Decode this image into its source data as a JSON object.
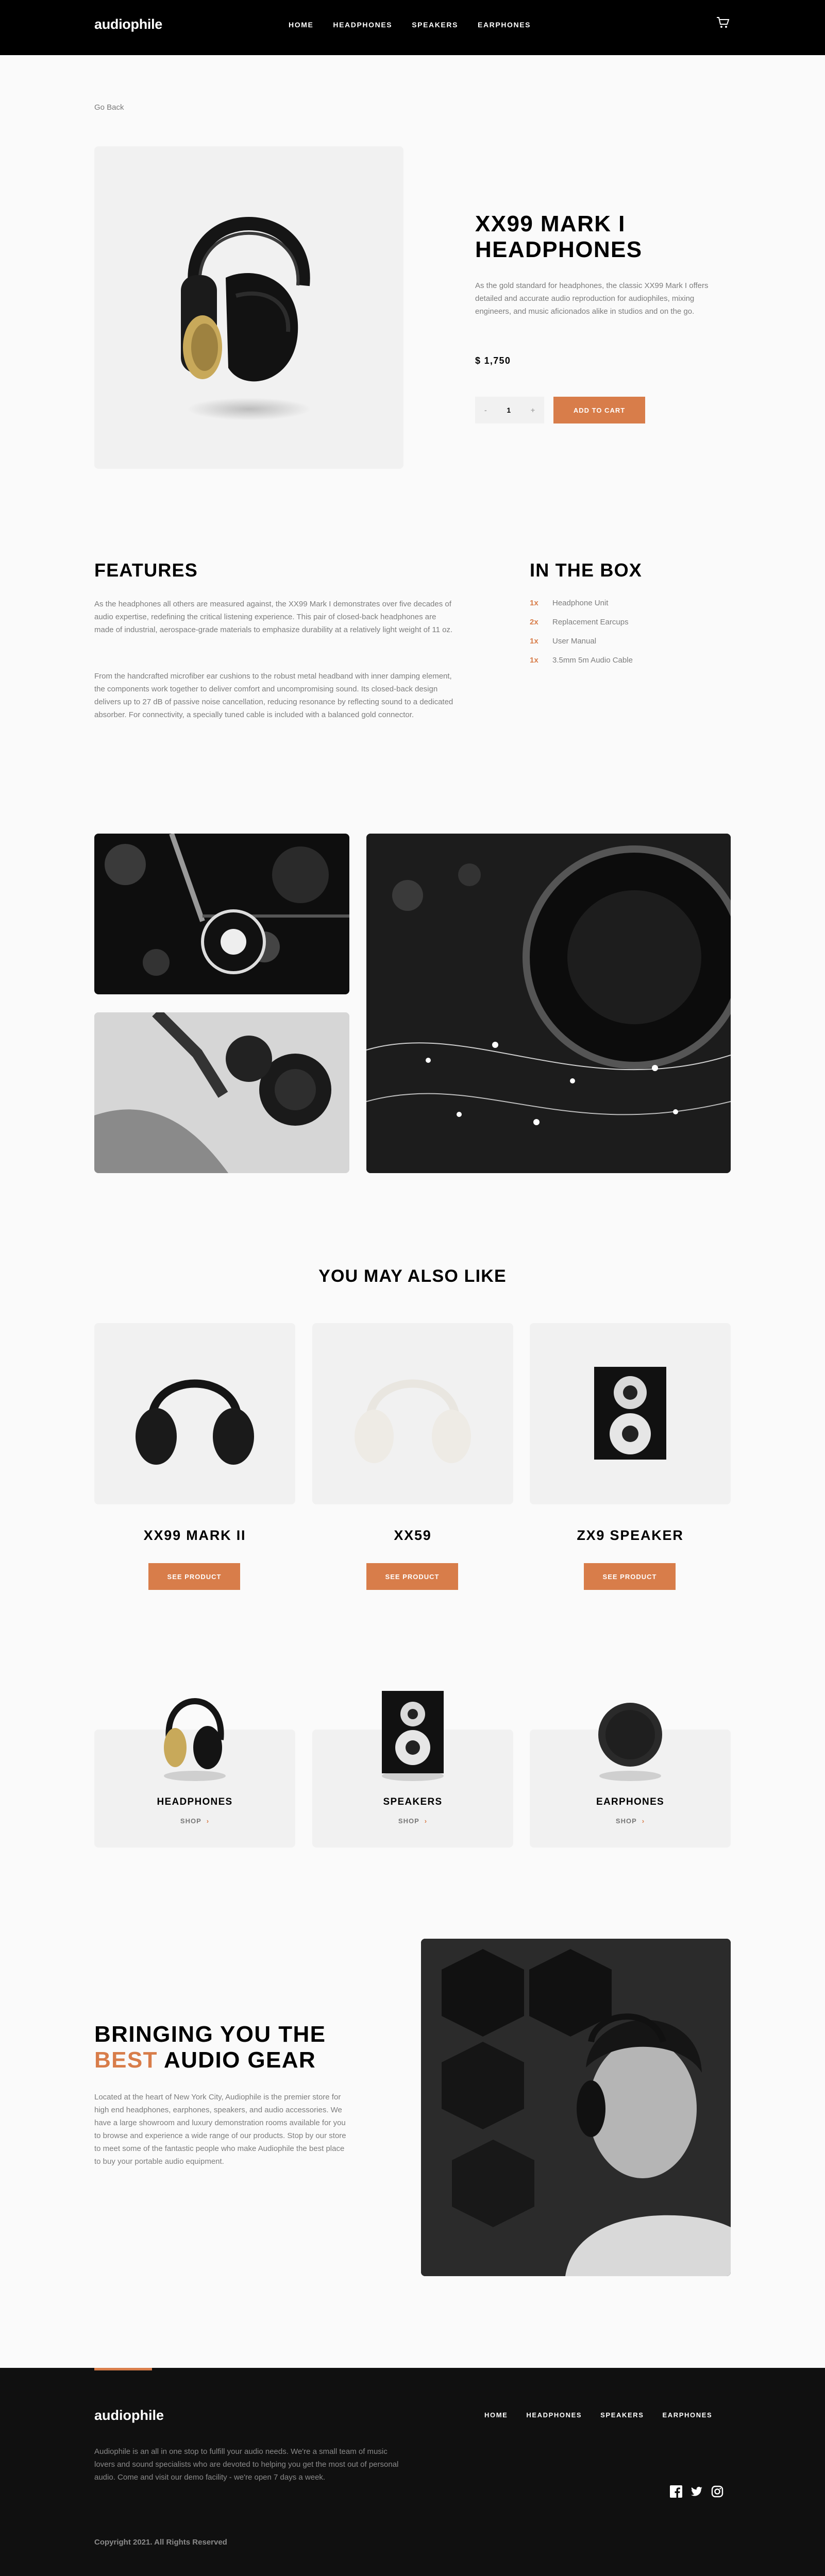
{
  "header": {
    "logo": "audiophile",
    "nav": [
      "HOME",
      "HEADPHONES",
      "SPEAKERS",
      "EARPHONES"
    ]
  },
  "go_back": "Go Back",
  "product": {
    "title": "XX99 MARK I HEADPHONES",
    "description": "As the gold standard for headphones, the classic XX99 Mark I offers detailed and accurate audio reproduction for audiophiles, mixing engineers, and music aficionados alike in studios and on the go.",
    "price": "$ 1,750",
    "quantity": "1",
    "minus": "-",
    "plus": "+",
    "add_to_cart": "ADD TO CART"
  },
  "features": {
    "title": "FEATURES",
    "p1": "As the headphones all others are measured against, the XX99 Mark I demonstrates over five decades of audio expertise, redefining the critical listening experience. This pair of closed-back headphones are made of industrial, aerospace-grade materials to emphasize durability at a relatively light weight of 11 oz.",
    "p2": "From the handcrafted microfiber ear cushions to the robust metal headband with inner damping element, the components work together to deliver comfort and uncompromising sound. Its closed-back design delivers up to 27 dB of passive noise cancellation, reducing resonance by reflecting sound to a dedicated absorber. For connectivity, a specially tuned cable is included with a balanced gold connector."
  },
  "in_the_box": {
    "title": "IN THE BOX",
    "items": [
      {
        "qty": "1x",
        "name": "Headphone Unit"
      },
      {
        "qty": "2x",
        "name": "Replacement Earcups"
      },
      {
        "qty": "1x",
        "name": "User Manual"
      },
      {
        "qty": "1x",
        "name": "3.5mm 5m Audio Cable"
      }
    ]
  },
  "also_like": {
    "title": "YOU MAY ALSO LIKE",
    "items": [
      {
        "name": "XX99 MARK II",
        "button": "SEE PRODUCT"
      },
      {
        "name": "XX59",
        "button": "SEE PRODUCT"
      },
      {
        "name": "ZX9 SPEAKER",
        "button": "SEE PRODUCT"
      }
    ]
  },
  "categories": [
    {
      "name": "HEADPHONES",
      "shop": "SHOP"
    },
    {
      "name": "SPEAKERS",
      "shop": "SHOP"
    },
    {
      "name": "EARPHONES",
      "shop": "SHOP"
    }
  ],
  "about": {
    "title_1": "BRINGING YOU THE",
    "title_accent": "BEST",
    "title_2": "AUDIO GEAR",
    "text": "Located at the heart of New York City, Audiophile is the premier store for high end headphones, earphones, speakers, and audio accessories. We have a large showroom and luxury demonstration rooms available for you to browse and experience a wide range of our products. Stop by our store to meet some of the fantastic people who make Audiophile the best place to buy your portable audio equipment."
  },
  "footer": {
    "logo": "audiophile",
    "nav": [
      "HOME",
      "HEADPHONES",
      "SPEAKERS",
      "EARPHONES"
    ],
    "description": "Audiophile is an all in one stop to fulfill your audio needs. We're a small team of music lovers and sound specialists who are devoted to helping you get the most out of personal audio. Come and visit our demo facility - we're open 7 days a week.",
    "copyright": "Copyright 2021. All Rights Reserved",
    "social_icons": [
      "facebook-icon",
      "twitter-icon",
      "instagram-icon"
    ]
  },
  "colors": {
    "accent": "#d87d4a",
    "dark": "#000000",
    "panel": "#f1f1f1"
  }
}
